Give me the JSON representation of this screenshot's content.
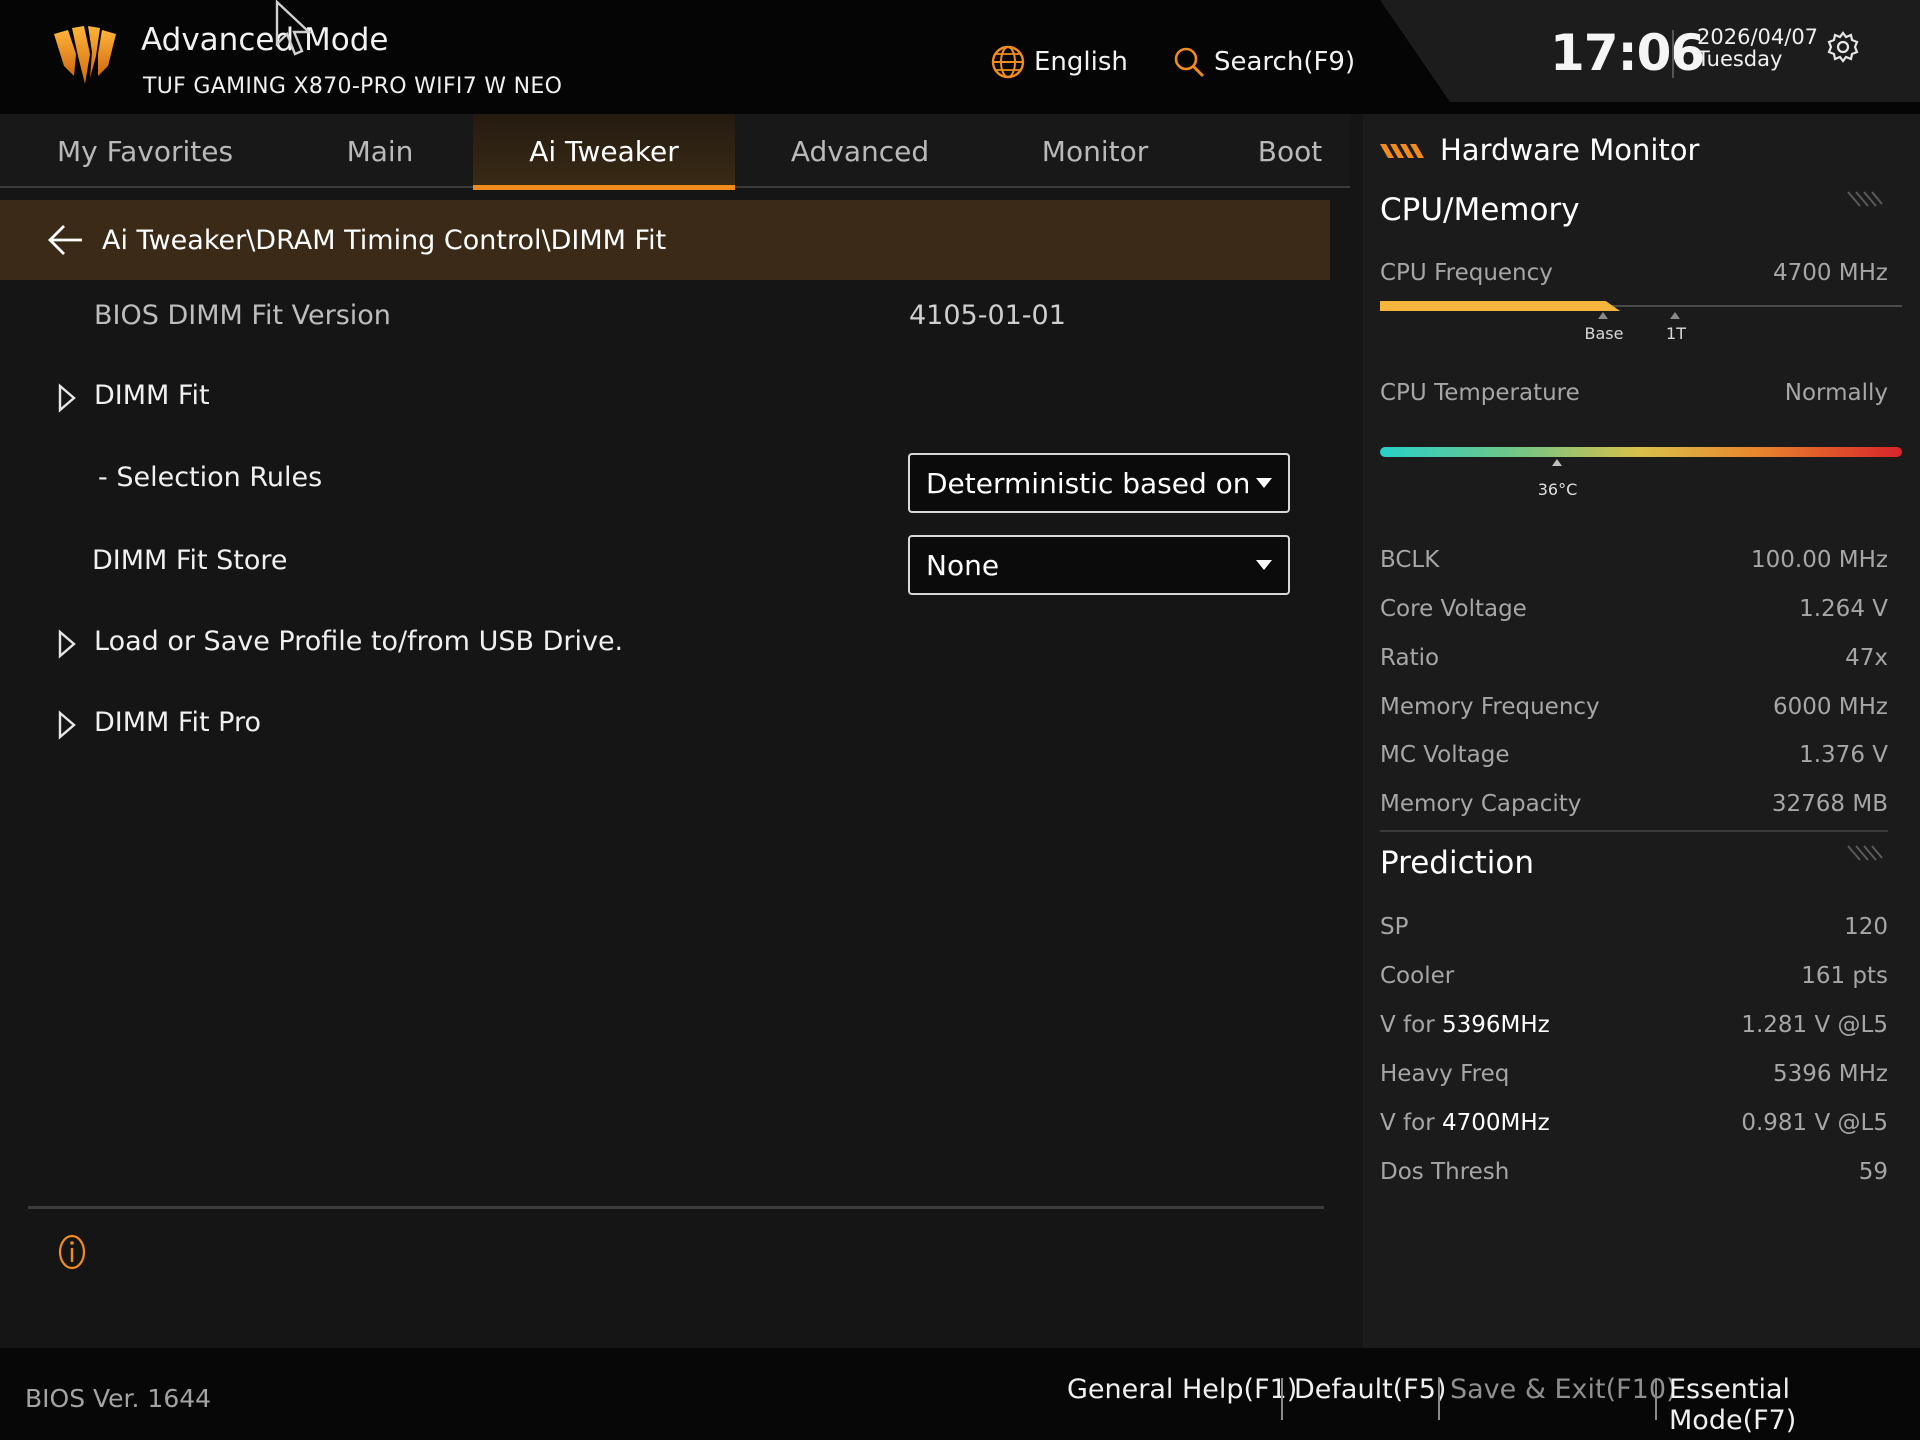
{
  "header": {
    "mode_title": "Advanced Mode",
    "board_name": "TUF GAMING X870-PRO WIFI7 W NEO",
    "language_label": "English",
    "search_label": "Search(F9)",
    "time": "17:06",
    "date": "2026/04/07",
    "weekday": "Tuesday",
    "icons": {
      "language": "globe-icon",
      "search": "search-icon",
      "settings": "gear-icon"
    }
  },
  "tabs": [
    {
      "label": "My Favorites",
      "active": false
    },
    {
      "label": "Main",
      "active": false
    },
    {
      "label": "Ai Tweaker",
      "active": true
    },
    {
      "label": "Advanced",
      "active": false
    },
    {
      "label": "Monitor",
      "active": false
    },
    {
      "label": "Boot",
      "active": false
    }
  ],
  "breadcrumb": {
    "path": "Ai Tweaker\\DRAM Timing Control\\DIMM Fit"
  },
  "settings": {
    "bios_dimm_fit_version": {
      "label": "BIOS DIMM Fit Version",
      "value": "4105-01-01"
    },
    "dimm_fit": {
      "label": "DIMM Fit"
    },
    "selection_rules": {
      "label": "- Selection Rules",
      "value": "Deterministic based on W"
    },
    "dimm_fit_store": {
      "label": "DIMM Fit Store",
      "value": "None"
    },
    "load_save_profile": {
      "label": "Load or Save Profile to/from USB Drive."
    },
    "dimm_fit_pro": {
      "label": "DIMM Fit Pro"
    }
  },
  "hardware_monitor": {
    "title": "Hardware Monitor",
    "cpu_memory": {
      "title": "CPU/Memory",
      "cpu_frequency": {
        "label": "CPU Frequency",
        "value": "4700 MHz",
        "bar_fraction": 0.46,
        "marker_base": "Base",
        "marker_1t": "1T"
      },
      "cpu_temperature": {
        "label": "CPU Temperature",
        "value": "Normally",
        "reading": "36°C",
        "marker_fraction": 0.34
      },
      "items": [
        {
          "label": "BCLK",
          "value": "100.00 MHz"
        },
        {
          "label": "Core Voltage",
          "value": "1.264 V"
        },
        {
          "label": "Ratio",
          "value": "47x"
        },
        {
          "label": "Memory Frequency",
          "value": "6000 MHz"
        },
        {
          "label": "MC Voltage",
          "value": "1.376 V"
        },
        {
          "label": "Memory Capacity",
          "value": "32768 MB"
        }
      ]
    },
    "prediction": {
      "title": "Prediction",
      "sp": {
        "label": "SP",
        "value": "120"
      },
      "cooler": {
        "label": "Cooler",
        "value": "161 pts"
      },
      "v_for_high": {
        "label_prefix": "V for",
        "label_freq": "5396MHz",
        "value": "1.281 V @L5"
      },
      "heavy_freq": {
        "label": "Heavy Freq",
        "value": "5396 MHz"
      },
      "v_for_low": {
        "label_prefix": "V for",
        "label_freq": "4700MHz",
        "value": "0.981 V @L5"
      },
      "dos_thresh": {
        "label": "Dos Thresh",
        "value": "59"
      }
    }
  },
  "footer": {
    "bios_version": "BIOS Ver. 1644",
    "general_help": "General Help(F1)",
    "default": "Default(F5)",
    "save_exit": "Save & Exit(F10)",
    "essential_mode": "Essential Mode(F7)"
  },
  "colors": {
    "accent": "#f08c1e",
    "breadcrumb_bg": "#3a2a17",
    "panel_bg": "#1b1b1b"
  }
}
